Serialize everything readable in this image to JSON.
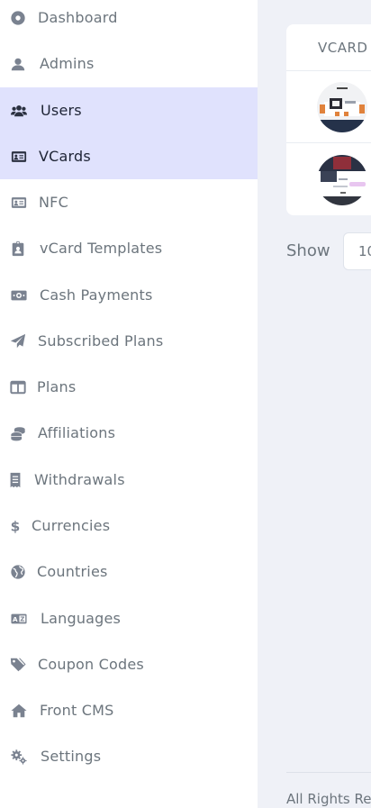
{
  "sidebar": {
    "items": [
      {
        "label": "Dashboard",
        "icon": "dashboard-icon",
        "active": false
      },
      {
        "label": "Admins",
        "icon": "admin-user-icon",
        "active": false
      },
      {
        "label": "Users",
        "icon": "users-icon",
        "active": true
      },
      {
        "label": "VCards",
        "icon": "id-card-icon",
        "active": true
      },
      {
        "label": "NFC",
        "icon": "nfc-card-icon",
        "active": false
      },
      {
        "label": "vCard Templates",
        "icon": "id-badge-icon",
        "active": false
      },
      {
        "label": "Cash Payments",
        "icon": "money-bill-icon",
        "active": false
      },
      {
        "label": "Subscribed Plans",
        "icon": "paper-plane-icon",
        "active": false
      },
      {
        "label": "Plans",
        "icon": "columns-icon",
        "active": false
      },
      {
        "label": "Affiliations",
        "icon": "coins-icon",
        "active": false
      },
      {
        "label": "Withdrawals",
        "icon": "receipt-icon",
        "active": false
      },
      {
        "label": "Currencies",
        "icon": "dollar-icon",
        "active": false
      },
      {
        "label": "Countries",
        "icon": "globe-icon",
        "active": false
      },
      {
        "label": "Languages",
        "icon": "language-icon",
        "active": false
      },
      {
        "label": "Coupon Codes",
        "icon": "tags-icon",
        "active": false
      },
      {
        "label": "Front CMS",
        "icon": "home-icon",
        "active": false
      },
      {
        "label": "Settings",
        "icon": "cogs-icon",
        "active": false
      }
    ]
  },
  "table": {
    "column_header": "VCARD",
    "rows": [
      {
        "thumbnail": "vcard-thumbnail-icon"
      },
      {
        "thumbnail": "vcard-thumbnail-icon"
      }
    ]
  },
  "pagination": {
    "show_label": "Show",
    "page_size": "10"
  },
  "footer": {
    "text": "All Rights Re"
  },
  "colors": {
    "active_bg": "#e0e2fd",
    "text_muted": "#6c757d",
    "icon": "#7a8290",
    "main_bg": "#eff1f7"
  }
}
